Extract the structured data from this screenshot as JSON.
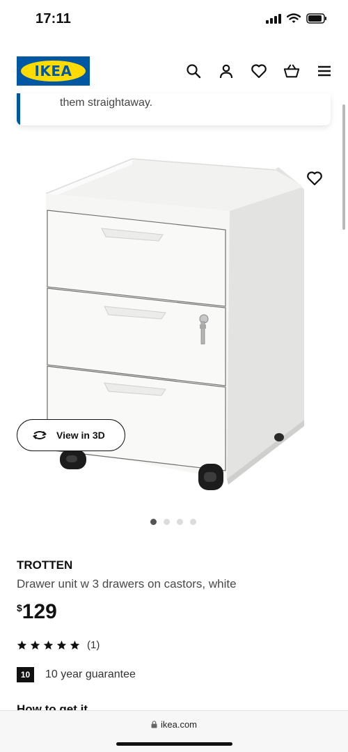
{
  "status_bar": {
    "time": "17:11"
  },
  "header": {
    "logo_text": "IKEA"
  },
  "notice": {
    "text": "them straightaway."
  },
  "product": {
    "image_alt": "TROTTEN drawer unit",
    "view3d_label": "View in 3D",
    "image_count": 4,
    "active_image": 1,
    "name": "TROTTEN",
    "description": "Drawer unit w 3 drawers on castors, white",
    "price_currency": "$",
    "price_value": "129",
    "rating": {
      "stars": 5,
      "count_label": "(1)"
    },
    "guarantee": {
      "badge": "10",
      "text": "10 year guarantee"
    },
    "next_section_partial": "How to get it"
  },
  "browser": {
    "url": "ikea.com"
  },
  "colors": {
    "ikea_blue": "#0058a3",
    "ikea_yellow": "#ffdb00"
  }
}
